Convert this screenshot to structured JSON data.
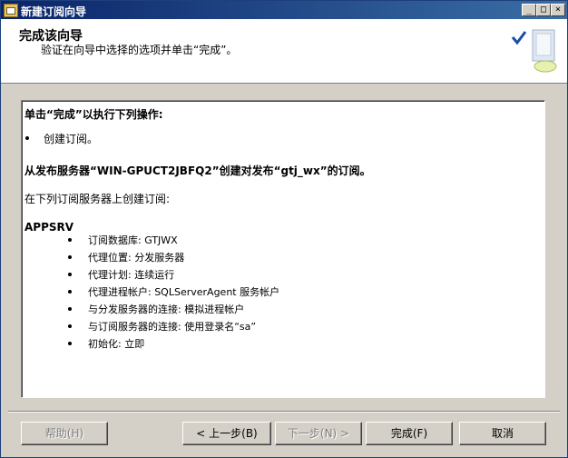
{
  "window": {
    "title": "新建订阅向导",
    "controls": {
      "minimize": "_",
      "maximize": "□",
      "close": "×"
    }
  },
  "header": {
    "title": "完成该向导",
    "subtitle": "验证在向导中选择的选项并单击“完成”。"
  },
  "summary": {
    "heading": "单击“完成”以执行下列操作:",
    "action": "创建订阅。",
    "publisher_line": "从发布服务器“WIN-GPUCT2JBFQ2”创建对发布“gtj_wx”的订阅。",
    "subscriber_intro": "在下列订阅服务器上创建订阅:",
    "subscriber": "APPSRV",
    "details": [
      "订阅数据库: GTJWX",
      "代理位置: 分发服务器",
      "代理计划: 连续运行",
      "代理进程帐户: SQLServerAgent 服务帐户",
      "与分发服务器的连接: 模拟进程帐户",
      "与订阅服务器的连接: 使用登录名“sa”",
      "初始化: 立即"
    ]
  },
  "buttons": {
    "help": "帮助(H)",
    "back": "< 上一步(B)",
    "next": "下一步(N) >",
    "finish": "完成(F)",
    "cancel": "取消"
  },
  "colors": {
    "titlebar": "#0a246a",
    "dialog_bg": "#d4d0c8",
    "checkmark": "#1a4ea8"
  }
}
